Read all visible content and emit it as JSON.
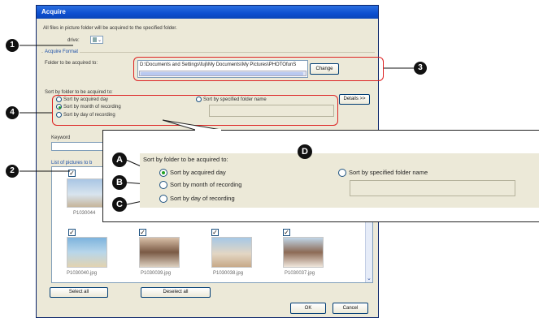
{
  "dialog": {
    "title": "Acquire",
    "intro": "All files in picture folder will be acquired to the specified folder.",
    "drive_label": "drive:",
    "drive_value": "E",
    "acquire_format_title": "Acquire Format",
    "folder_label": "Folder to be acquired to:",
    "folder_path": "D:\\Documents and Settings\\fuji\\My Documents\\My Pictures\\PHOTOfunS",
    "change_button": "Change",
    "sort_label": "Sort by folder to be acquired to:",
    "details_button": "Details >>",
    "sort_options": {
      "acquired_day": "Sort by acquired day",
      "month": "Sort by month of recording",
      "day": "Sort by day of recording",
      "specified": "Sort by specified folder name"
    },
    "keyword_label": "Keyword",
    "pictures_title": "List of pictures to b",
    "thumbnails_row1": [
      "P1030044"
    ],
    "thumbnails_row2": [
      "P1030040.jpg",
      "P1030039.jpg",
      "P1030038.jpg",
      "P1030037.jpg"
    ],
    "select_all": "Select all",
    "deselect_all": "Deselect all",
    "ok": "OK",
    "cancel": "Cancel"
  },
  "zoom": {
    "sort_label": "Sort by folder to be acquired to:",
    "acquired_day": "Sort by acquired day",
    "month": "Sort by month of recording",
    "day": "Sort by day of recording",
    "specified": "Sort by specified folder name"
  },
  "markers": {
    "n1": "1",
    "n2": "2",
    "n3": "3",
    "n4": "4",
    "a": "A",
    "b": "B",
    "c": "C",
    "d": "D"
  },
  "colors": {
    "callout_red": "#dd2222",
    "title_blue": "#0c4fd0",
    "radio_green": "#21a121"
  }
}
